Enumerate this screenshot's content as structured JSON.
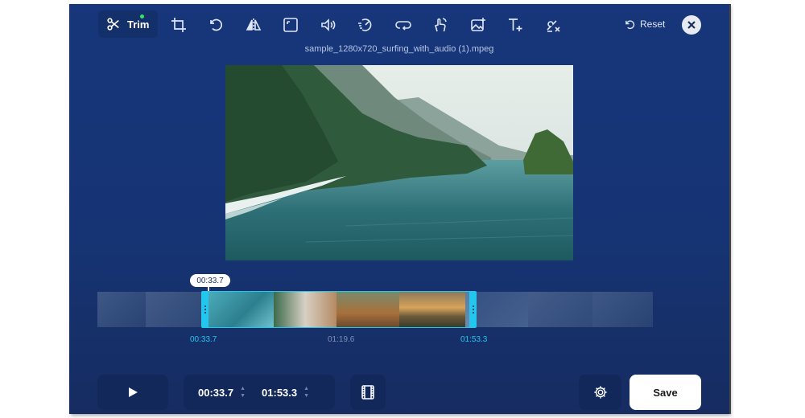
{
  "toolbar": {
    "trim_label": "Trim",
    "tools": [
      "trim-icon",
      "crop-icon",
      "rotate-icon",
      "flip-icon",
      "resize-icon",
      "volume-icon",
      "speed-icon",
      "loop-icon",
      "stabilize-icon",
      "add-image-icon",
      "add-text-icon",
      "remove-watermark-icon"
    ],
    "reset_label": "Reset"
  },
  "video": {
    "filename": "sample_1280x720_surfing_with_audio (1).mpeg"
  },
  "timeline": {
    "current_tooltip": "00:33.7",
    "start_label": "00:33.7",
    "mid_label": "01:19.6",
    "end_label": "01:53.3"
  },
  "controls": {
    "start_time": "00:33.7",
    "end_time": "01:53.3",
    "save_label": "Save"
  },
  "colors": {
    "background": "#17367b",
    "accent": "#22c6ee",
    "badge": "#2ee66b"
  }
}
